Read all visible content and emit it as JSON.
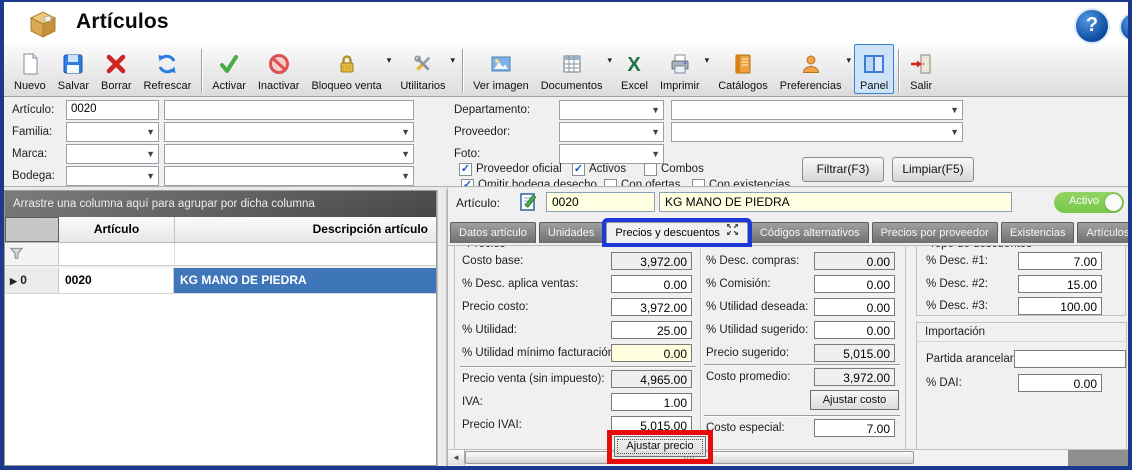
{
  "window": {
    "title": "Artículos"
  },
  "help": {
    "glyph": "?"
  },
  "toolbar": {
    "items": [
      {
        "label": "Nuevo",
        "icon": "new-document-icon"
      },
      {
        "label": "Salvar",
        "icon": "save-icon"
      },
      {
        "label": "Borrar",
        "icon": "delete-icon"
      },
      {
        "label": "Refrescar",
        "icon": "refresh-icon"
      },
      {
        "label": "Activar",
        "icon": "activate-check-icon"
      },
      {
        "label": "Inactivar",
        "icon": "inactivate-icon"
      },
      {
        "label": "Bloqueo venta",
        "icon": "lock-icon",
        "dropdown": true
      },
      {
        "label": "Utilitarios",
        "icon": "tools-icon",
        "dropdown": true
      },
      {
        "label": "Ver imagen",
        "icon": "image-icon"
      },
      {
        "label": "Documentos",
        "icon": "documents-grid-icon",
        "dropdown": true
      },
      {
        "label": "Excel",
        "icon": "excel-icon"
      },
      {
        "label": "Imprimir",
        "icon": "printer-icon",
        "dropdown": true
      },
      {
        "label": "Catálogos",
        "icon": "catalog-book-icon"
      },
      {
        "label": "Preferencias",
        "icon": "user-icon",
        "dropdown": true
      },
      {
        "label": "Panel",
        "icon": "panel-icon",
        "selected": true
      },
      {
        "label": "Salir",
        "icon": "exit-door-icon"
      }
    ]
  },
  "filters": {
    "articulo_label": "Artículo:",
    "articulo_value": "0020",
    "familia_label": "Familia:",
    "marca_label": "Marca:",
    "bodega_label": "Bodega:",
    "departamento_label": "Departamento:",
    "proveedor_label": "Proveedor:",
    "foto_label": "Foto:",
    "checkboxes": [
      {
        "label": "Proveedor oficial",
        "checked": true
      },
      {
        "label": "Activos",
        "checked": true
      },
      {
        "label": "Combos",
        "checked": false
      },
      {
        "label": "Omitir bodega desecho",
        "checked": true
      },
      {
        "label": "Con ofertas",
        "checked": false
      },
      {
        "label": "Con existencias",
        "checked": false
      }
    ],
    "filtrar_button": "Filtrar(F3)",
    "limpiar_button": "Limpiar(F5)",
    "check_glyph": "✓"
  },
  "grid": {
    "groupby_hint": "Arrastre una columna aquí para agrupar por dicha columna",
    "columns": [
      "Artículo",
      "Descripción artículo"
    ],
    "rows": [
      {
        "indicator": "▶",
        "row_number": "0",
        "articulo": "0020",
        "descripcion": "KG MANO DE PIEDRA",
        "selected": true
      }
    ]
  },
  "detail": {
    "articulo_label": "Artículo:",
    "codigo": "0020",
    "descripcion": "KG MANO DE PIEDRA",
    "estado_toggle": "Activo",
    "tabs": [
      {
        "label": "Datos artículo"
      },
      {
        "label": "Unidades"
      },
      {
        "label": "Precios y descuentos",
        "selected": true,
        "annotated": "blue-highlight"
      },
      {
        "label": "Códigos alternativos"
      },
      {
        "label": "Precios por proveedor"
      },
      {
        "label": "Existencias"
      },
      {
        "label": "Artículos relacio"
      }
    ],
    "groups": {
      "precios_title": "Precios",
      "tope_title": "Tope de descuentos",
      "importacion_title": "Importación"
    },
    "fields": {
      "costo_base": {
        "label": "Costo base:",
        "value": "3,972.00"
      },
      "desc_aplica_ventas": {
        "label": "% Desc. aplica ventas:",
        "value": "0.00"
      },
      "precio_costo": {
        "label": "Precio costo:",
        "value": "3,972.00"
      },
      "utilidad": {
        "label": "% Utilidad:",
        "value": "25.00"
      },
      "utilidad_minimo": {
        "label": "% Utilidad mínimo facturación:",
        "value": "0.00"
      },
      "precio_venta": {
        "label": "Precio venta (sin impuesto):",
        "value": "4,965.00"
      },
      "iva": {
        "label": "IVA:",
        "value": "1.00"
      },
      "precio_ivai": {
        "label": "Precio IVAI:",
        "value": "5,015.00"
      },
      "desc_compras": {
        "label": "% Desc. compras:",
        "value": "0.00"
      },
      "comision": {
        "label": "% Comisión:",
        "value": "0.00"
      },
      "utilidad_deseada": {
        "label": "% Utilidad deseada:",
        "value": "0.00"
      },
      "utilidad_sugerido": {
        "label": "% Utilidad sugerido:",
        "value": "0.00"
      },
      "precio_sugerido": {
        "label": "Precio sugerido:",
        "value": "5,015.00"
      },
      "costo_promedio": {
        "label": "Costo promedio:",
        "value": "3,972.00"
      },
      "costo_especial": {
        "label": "Costo especial:",
        "value": "7.00"
      },
      "desc1": {
        "label": "% Desc. #1:",
        "value": "7.00"
      },
      "desc2": {
        "label": "% Desc. #2:",
        "value": "15.00"
      },
      "desc3": {
        "label": "% Desc. #3:",
        "value": "100.00"
      },
      "partida": {
        "label": "Partida arancelaria:",
        "value": ""
      },
      "dai": {
        "label": "% DAI:",
        "value": "0.00"
      }
    },
    "buttons": {
      "ajustar_precio": "Ajustar precio",
      "ajustar_costo": "Ajustar costo"
    },
    "annotations": {
      "red_box_color": "#e60c0c",
      "blue_box_color": "#1d38d9"
    }
  }
}
